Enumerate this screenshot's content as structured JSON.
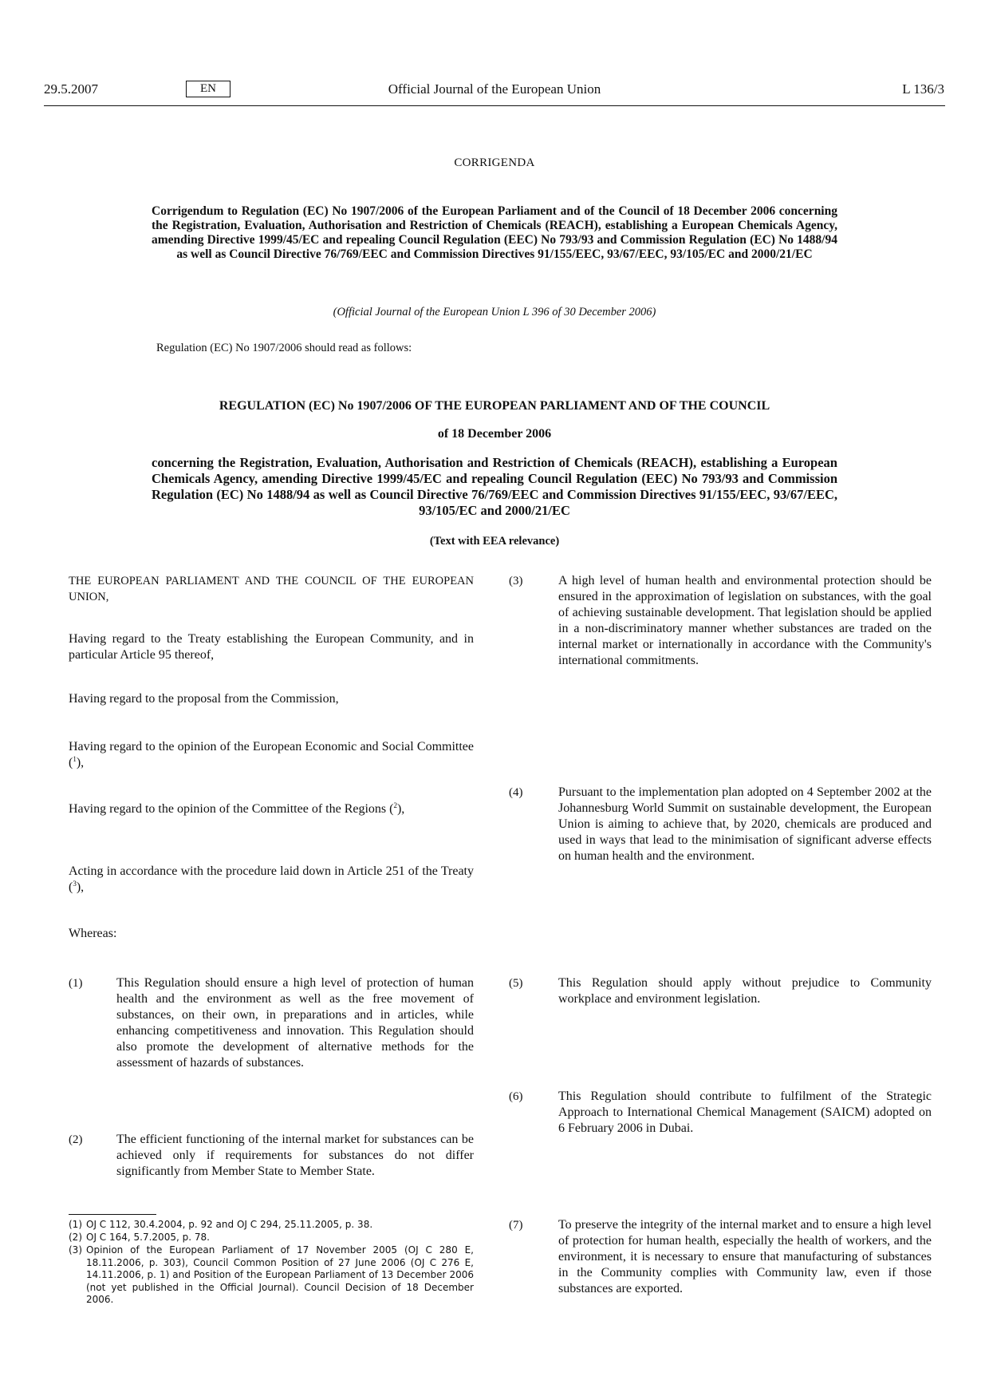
{
  "header": {
    "date": "29.5.2007",
    "language": "EN",
    "journal": "Official Journal of the European Union",
    "page": "L 136/3"
  },
  "corrigenda": {
    "heading": "CORRIGENDA",
    "title": "Corrigendum to Regulation (EC) No 1907/2006 of the European Parliament and of the Council of 18 December 2006 concerning the Registration, Evaluation, Authorisation and Restriction of Chemicals (REACH), establishing a European Chemicals Agency, amending Directive 1999/45/EC and repealing Council Regulation (EEC) No 793/93 and Commission Regulation (EC) No 1488/94 as well as Council Directive 76/769/EEC and Commission Directives 91/155/EEC, 93/67/EEC, 93/105/EC and 2000/21/EC",
    "oj_reference": "(Official Journal of the European Union L 396 of 30 December 2006)",
    "read_as": "Regulation (EC) No 1907/2006 should read as follows:"
  },
  "regulation": {
    "title": "REGULATION (EC) No 1907/2006 OF THE EUROPEAN PARLIAMENT AND OF THE COUNCIL",
    "date": "of 18 December 2006",
    "concerning": "concerning the Registration, Evaluation, Authorisation and Restriction of Chemicals (REACH), establishing a European Chemicals Agency, amending Directive 1999/45/EC and repealing Council Regulation (EEC) No 793/93 and Commission Regulation (EC) No 1488/94 as well as Council Directive 76/769/EEC and Commission Directives 91/155/EEC, 93/67/EEC, 93/105/EC and 2000/21/EC",
    "eea": "(Text with EEA relevance)"
  },
  "preamble": {
    "parties": "THE EUROPEAN PARLIAMENT AND THE COUNCIL OF THE EUROPEAN UNION,",
    "citations": [
      {
        "text": "Having regard to the Treaty establishing the European Community, and in particular Article 95 thereof,",
        "ref": ""
      },
      {
        "text": "Having regard to the proposal from the Commission,",
        "ref": ""
      },
      {
        "text": "Having regard to the opinion of the European Economic and Social Committee (",
        "ref": "1",
        "after": "),"
      },
      {
        "text": "Having regard to the opinion of the Committee of the Regions (",
        "ref": "2",
        "after": "),"
      },
      {
        "text": "Acting in accordance with the procedure laid down in Article 251 of the Treaty (",
        "ref": "3",
        "after": "),"
      }
    ],
    "whereas": "Whereas:"
  },
  "recitals": [
    {
      "num": "(1)",
      "text": "This Regulation should ensure a high level of protection of human health and the environment as well as the free movement of substances, on their own, in preparations and in articles, while enhancing competitiveness and innovation. This Regulation should also promote the development of alternative methods for the assessment of hazards of substances."
    },
    {
      "num": "(2)",
      "text": "The efficient functioning of the internal market for substances can be achieved only if requirements for substances do not differ significantly from Member State to Member State."
    },
    {
      "num": "(3)",
      "text": "A high level of human health and environmental protection should be ensured in the approximation of legislation on substances, with the goal of achieving sustainable development. That legislation should be applied in a non-discriminatory manner whether substances are traded on the internal market or internationally in accordance with the Community's international commitments."
    },
    {
      "num": "(4)",
      "text": "Pursuant to the implementation plan adopted on 4 September 2002 at the Johannesburg World Summit on sustainable development, the European Union is aiming to achieve that, by 2020, chemicals are produced and used in ways that lead to the minimisation of significant adverse effects on human health and the environment."
    },
    {
      "num": "(5)",
      "text": "This Regulation should apply without prejudice to Community workplace and environment legislation."
    },
    {
      "num": "(6)",
      "text": "This Regulation should contribute to fulfilment of the Strategic Approach to International Chemical Management (SAICM) adopted on 6 February 2006 in Dubai."
    },
    {
      "num": "(7)",
      "text": "To preserve the integrity of the internal market and to ensure a high level of protection for human health, especially the health of workers, and the environment, it is necessary to ensure that manufacturing of substances in the Community complies with Community law, even if those substances are exported."
    }
  ],
  "footnotes": [
    {
      "num": "(1)",
      "text": "OJ C 112, 30.4.2004, p. 92 and OJ C 294, 25.11.2005, p. 38."
    },
    {
      "num": "(2)",
      "text": "OJ C 164, 5.7.2005, p. 78."
    },
    {
      "num": "(3)",
      "text": "Opinion of the European Parliament of 17 November 2005 (OJ C 280 E, 18.11.2006, p. 303), Council Common Position of 27 June 2006 (OJ C 276 E, 14.11.2006, p. 1) and Position of the European Parliament of 13 December 2006 (not yet published in the Official Journal). Council Decision of 18 December 2006."
    }
  ]
}
